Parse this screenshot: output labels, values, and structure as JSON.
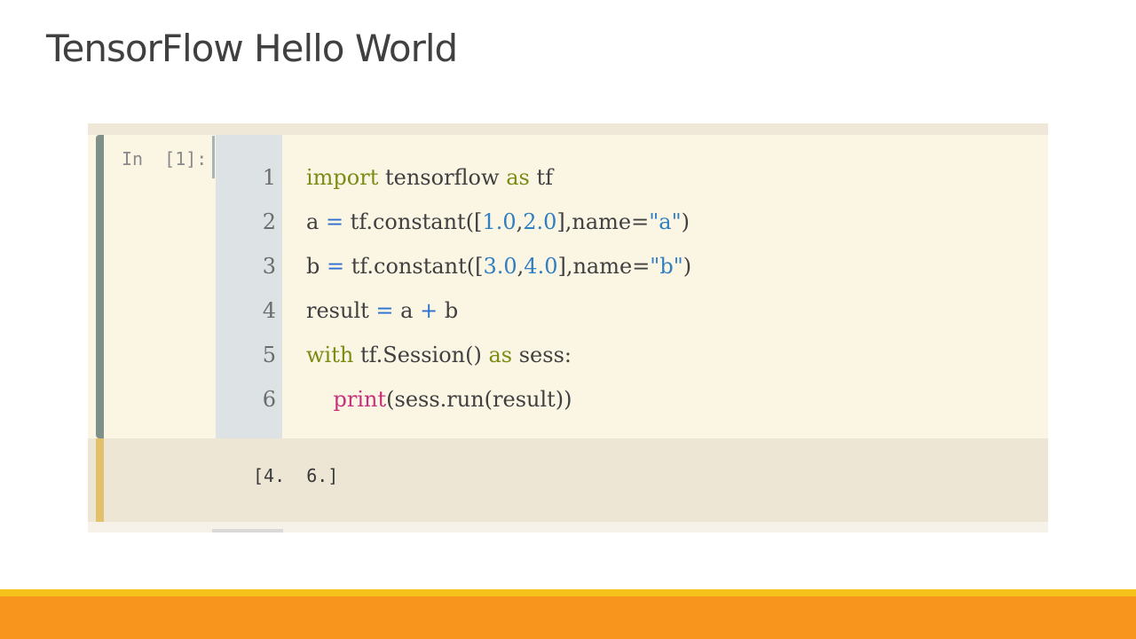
{
  "slide": {
    "title": "TensorFlow Hello World"
  },
  "notebook": {
    "prompt": "In  [1]:",
    "lines": [
      {
        "num": "1",
        "tokens": [
          {
            "t": "import",
            "c": "kw"
          },
          {
            "t": " tensorflow ",
            "c": ""
          },
          {
            "t": "as",
            "c": "kw"
          },
          {
            "t": " tf",
            "c": ""
          }
        ]
      },
      {
        "num": "2",
        "tokens": [
          {
            "t": "a ",
            "c": ""
          },
          {
            "t": "=",
            "c": "op"
          },
          {
            "t": " tf.constant([",
            "c": ""
          },
          {
            "t": "1.0",
            "c": "num"
          },
          {
            "t": ",",
            "c": ""
          },
          {
            "t": "2.0",
            "c": "num"
          },
          {
            "t": "],name=",
            "c": ""
          },
          {
            "t": "\"a\"",
            "c": "str"
          },
          {
            "t": ")",
            "c": ""
          }
        ]
      },
      {
        "num": "3",
        "tokens": [
          {
            "t": "b ",
            "c": ""
          },
          {
            "t": "=",
            "c": "op"
          },
          {
            "t": " tf.constant([",
            "c": ""
          },
          {
            "t": "3.0",
            "c": "num"
          },
          {
            "t": ",",
            "c": ""
          },
          {
            "t": "4.0",
            "c": "num"
          },
          {
            "t": "],name=",
            "c": ""
          },
          {
            "t": "\"b\"",
            "c": "str"
          },
          {
            "t": ")",
            "c": ""
          }
        ]
      },
      {
        "num": "4",
        "tokens": [
          {
            "t": "result ",
            "c": ""
          },
          {
            "t": "=",
            "c": "op"
          },
          {
            "t": " a ",
            "c": ""
          },
          {
            "t": "+",
            "c": "op"
          },
          {
            "t": " b",
            "c": ""
          }
        ]
      },
      {
        "num": "5",
        "tokens": [
          {
            "t": "with",
            "c": "kw"
          },
          {
            "t": " tf.Session() ",
            "c": ""
          },
          {
            "t": "as",
            "c": "kw"
          },
          {
            "t": " sess:",
            "c": ""
          }
        ]
      },
      {
        "num": "6",
        "tokens": [
          {
            "t": "    ",
            "c": ""
          },
          {
            "t": "print",
            "c": "builtin"
          },
          {
            "t": "(sess.run(result))",
            "c": ""
          }
        ]
      }
    ],
    "output": "[4.  6.]"
  },
  "colors": {
    "cell_background": "#fbf5e4",
    "gutter": "#dde2e4",
    "keyword": "#7b8c14",
    "number": "#2f7fc1",
    "builtin": "#c8307c",
    "footer_yellow": "#f4c21b",
    "footer_orange": "#f7951d"
  }
}
